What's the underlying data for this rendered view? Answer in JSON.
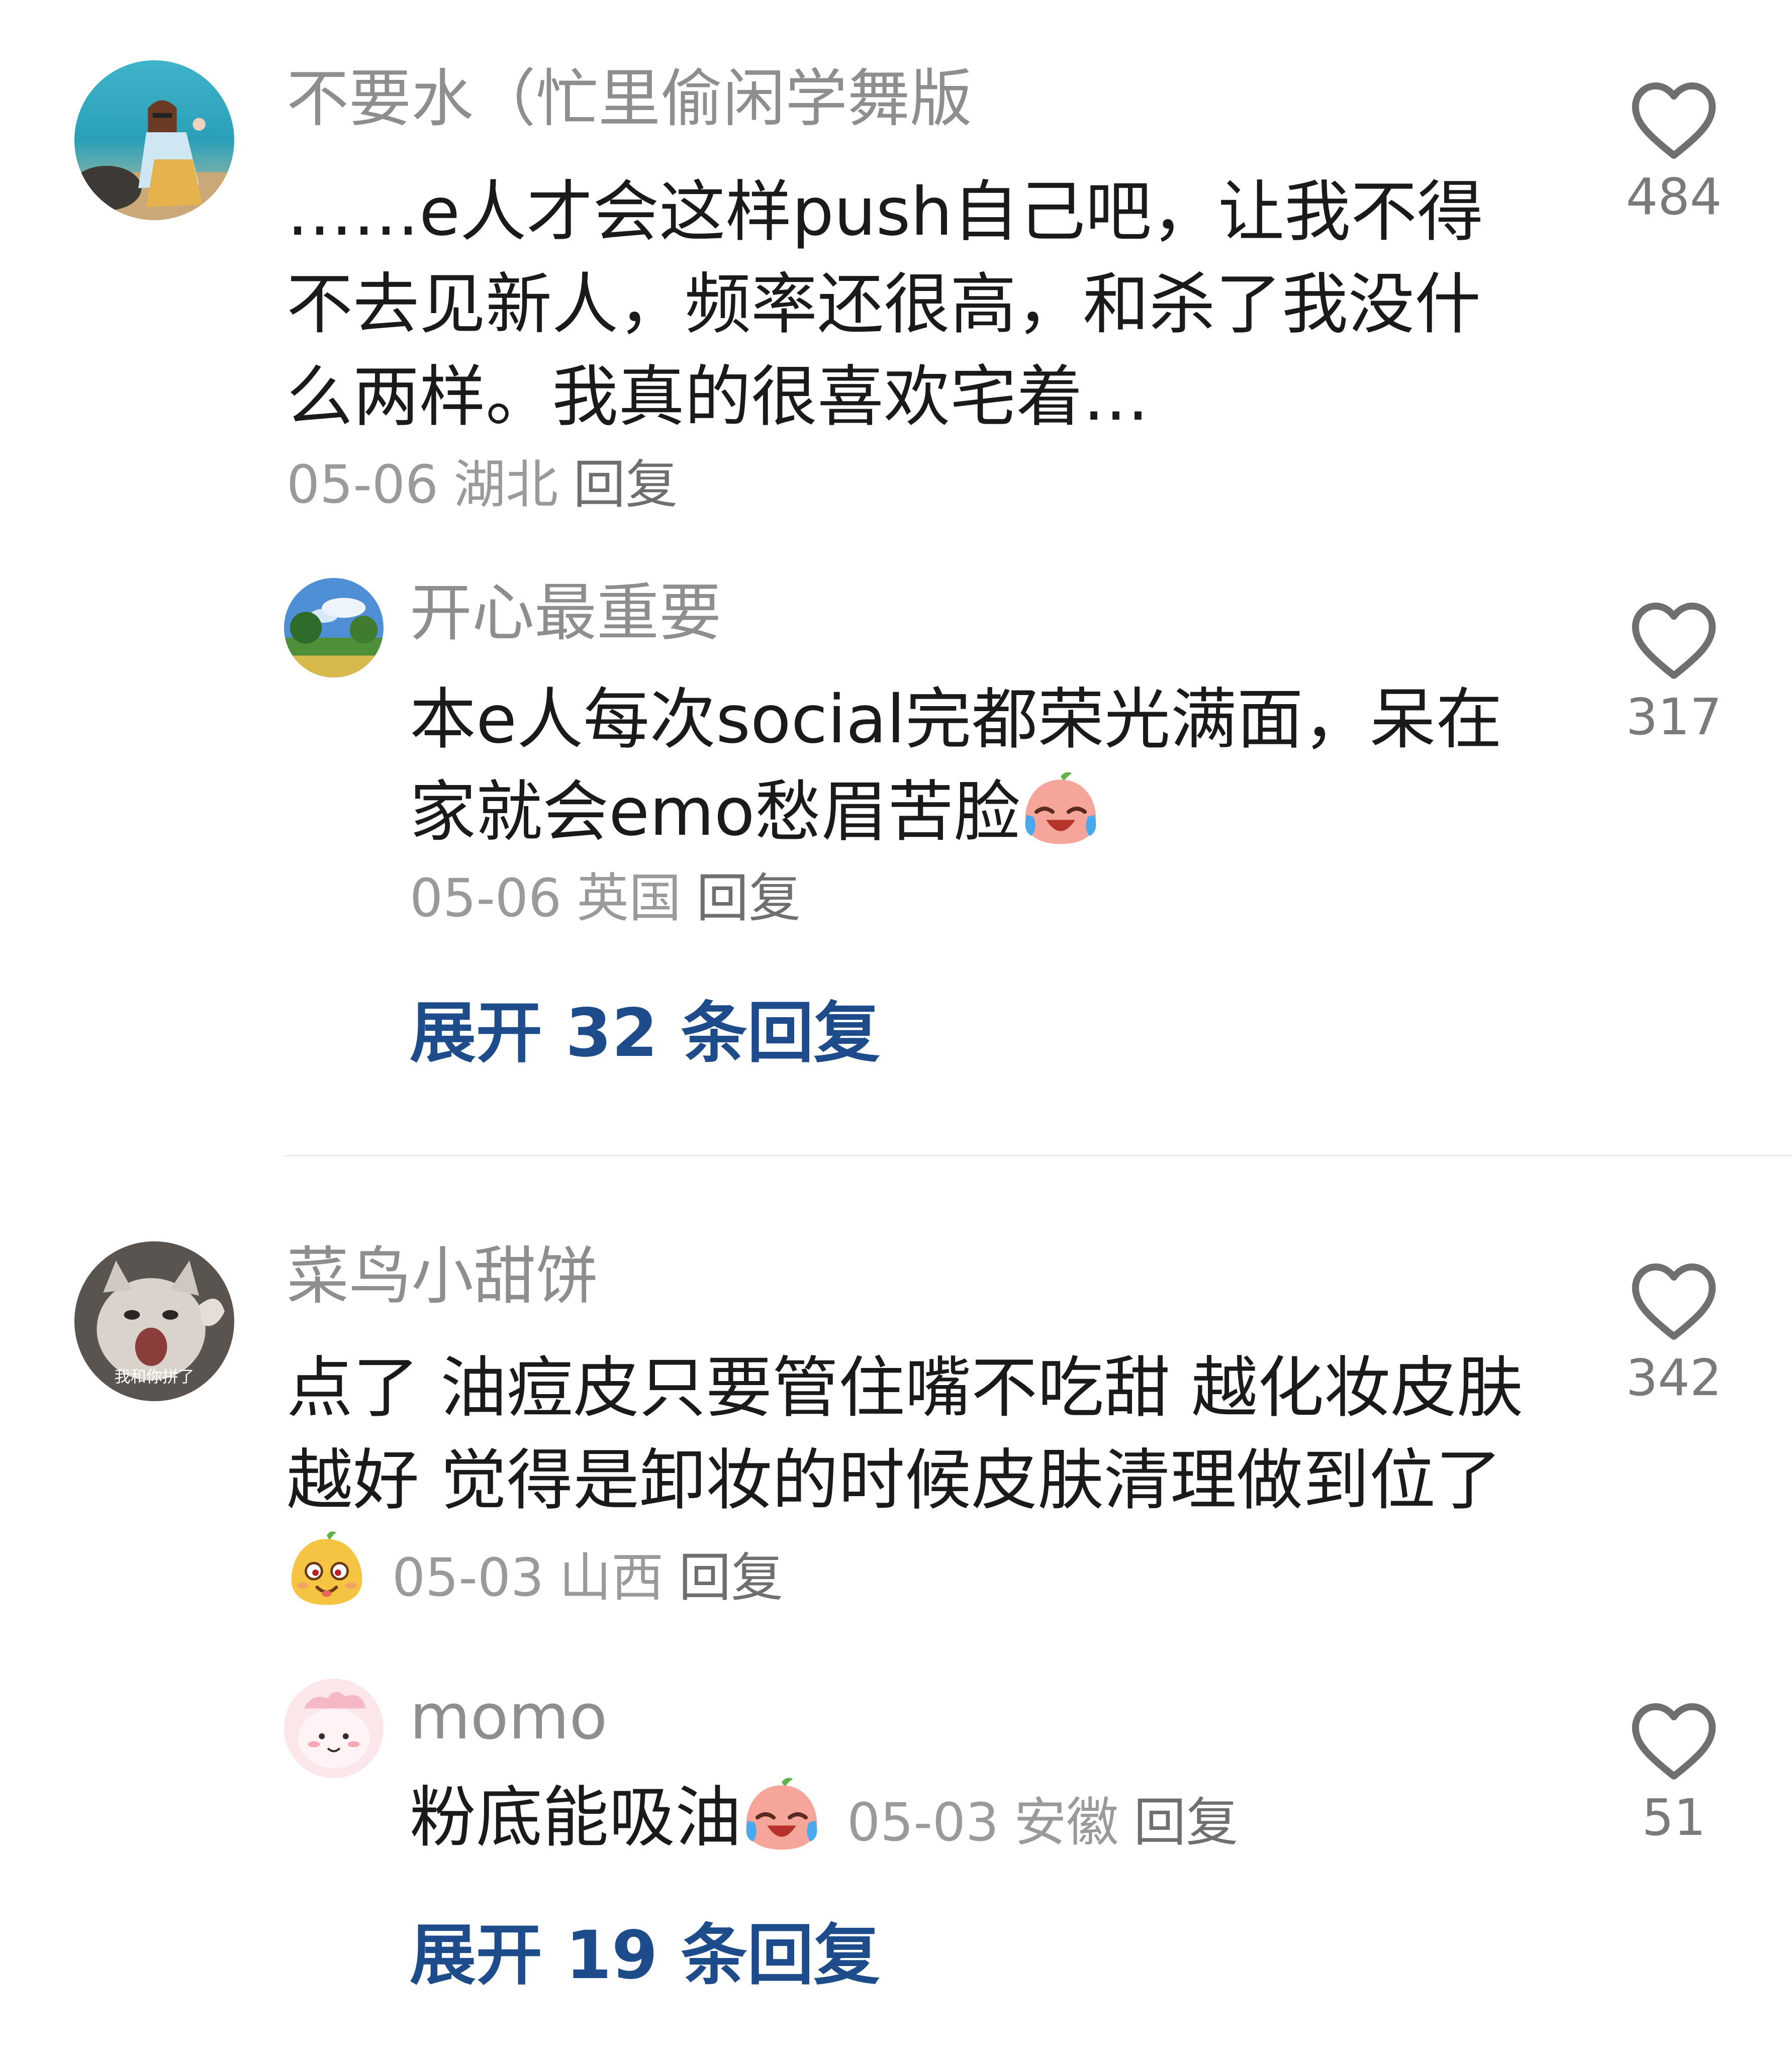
{
  "comments": [
    {
      "username": "不要水（忙里偷闲学舞版",
      "text": "……e人才会这样push自己吧，让我不得不去见新人，频率还很高，和杀了我没什么两样。我真的很喜欢宅着…",
      "date": "05-06",
      "location": "湖北",
      "reply_label": "回复",
      "likes": "484",
      "avatar_icon": "beach-photo-avatar",
      "replies": [
        {
          "username": "开心最重要",
          "text": "本e人每次social完都荣光满面，呆在家就会emo愁眉苦脸",
          "emoji": "crying-laughing-peach-emoji",
          "date": "05-06",
          "location": "英国",
          "reply_label": "回复",
          "likes": "317",
          "avatar_icon": "landscape-trees-avatar"
        }
      ],
      "expand_label": "展开 32 条回复"
    },
    {
      "username": "菜鸟小甜饼",
      "text": "点了 油痘皮只要管住嘴不吃甜 越化妆皮肤越好 觉得是卸妆的时候皮肤清理做到位了",
      "emoji": "silly-face-fruit-emoji",
      "date": "05-03",
      "location": "山西",
      "reply_label": "回复",
      "likes": "342",
      "avatar_icon": "screaming-cat-avatar",
      "avatar_caption": "我和你拼了",
      "replies": [
        {
          "username": "momo",
          "text": "粉底能吸油",
          "emoji": "crying-laughing-peach-emoji",
          "date": "05-03",
          "location": "安徽",
          "reply_label": "回复",
          "likes": "51",
          "avatar_icon": "pink-blob-avatar"
        }
      ],
      "expand_label": "展开 19 条回复"
    }
  ],
  "colors": {
    "username": "#8e8e8e",
    "text": "#1a1a1a",
    "meta": "#9a9a9a",
    "expand_link": "#1e4c8a",
    "like_icon": "#6f6f6f"
  }
}
